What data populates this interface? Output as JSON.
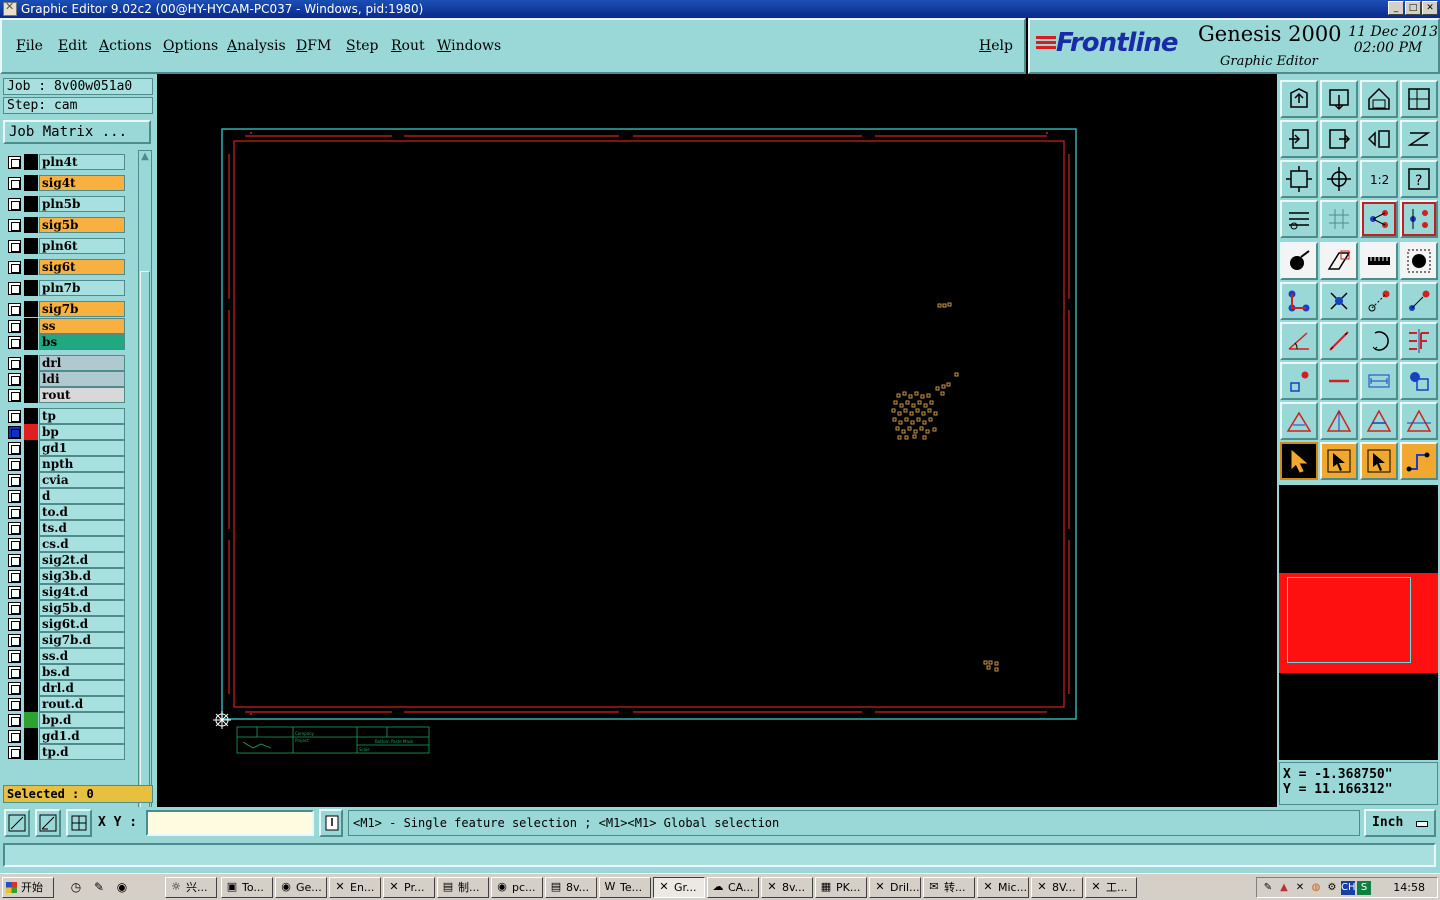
{
  "window": {
    "title": "Graphic Editor 9.02c2 (00@HY-HYCAM-PC037 - Windows, pid:1980)",
    "minimize": "_",
    "maximize": "□",
    "close": "✕"
  },
  "menu": {
    "items": [
      "File",
      "Edit",
      "Actions",
      "Options",
      "Analysis",
      "DFM",
      "Step",
      "Rout",
      "Windows"
    ],
    "help": "Help"
  },
  "brand": {
    "logo": "Frontline",
    "product": "Genesis 2000",
    "subtitle": "Graphic Editor",
    "date": "11 Dec 2013",
    "time": "02:00 PM"
  },
  "job": {
    "job_line": "Job : 8v00w051a0",
    "step_line": "Step: cam",
    "matrix_button": "Job Matrix ..."
  },
  "layers": [
    {
      "name": "pln4t",
      "color": "#a8e0e0",
      "mark": ""
    },
    {
      "name": "sig4t",
      "color": "#f8b040",
      "mark": "↵"
    },
    {
      "name": "pln5b",
      "color": "#a8e0e0",
      "mark": ""
    },
    {
      "name": "sig5b",
      "color": "#f8b040",
      "mark": "↵"
    },
    {
      "name": "pln6t",
      "color": "#a8e0e0",
      "mark": ""
    },
    {
      "name": "sig6t",
      "color": "#f8b040",
      "mark": "↵"
    },
    {
      "name": "pln7b",
      "color": "#a8e0e0",
      "mark": ""
    },
    {
      "name": "sig7b",
      "color": "#f8b040",
      "mark": "↵"
    },
    {
      "name": "ss",
      "color": "#f8b040",
      "mark": "↵"
    },
    {
      "name": "bs",
      "color": "#20a880",
      "mark": "↵"
    },
    {
      "name": "drl",
      "color": "#b0c8d0",
      "mark": ""
    },
    {
      "name": "ldi",
      "color": "#b0c8d0",
      "mark": ""
    },
    {
      "name": "rout",
      "color": "#d8d8d8",
      "mark": ""
    },
    {
      "name": "tp",
      "color": "#a8e0e0",
      "mark": "↵"
    },
    {
      "name": "bp",
      "color": "#a8e0e0",
      "mark": "↵ ⊞"
    },
    {
      "name": "gd1",
      "color": "#a8e0e0",
      "mark": "↵"
    },
    {
      "name": "npth",
      "color": "#a8e0e0",
      "mark": ""
    },
    {
      "name": "cvia",
      "color": "#a8e0e0",
      "mark": ""
    },
    {
      "name": "d",
      "color": "#a8e0e0",
      "mark": ""
    },
    {
      "name": "to.d",
      "color": "#a8e0e0",
      "mark": "↵"
    },
    {
      "name": "ts.d",
      "color": "#a8e0e0",
      "mark": "↵"
    },
    {
      "name": "cs.d",
      "color": "#a8e0e0",
      "mark": "↵"
    },
    {
      "name": "sig2t.d",
      "color": "#a8e0e0",
      "mark": "↵"
    },
    {
      "name": "sig3b.d",
      "color": "#a8e0e0",
      "mark": "↵"
    },
    {
      "name": "sig4t.d",
      "color": "#a8e0e0",
      "mark": "↵"
    },
    {
      "name": "sig5b.d",
      "color": "#a8e0e0",
      "mark": "↵"
    },
    {
      "name": "sig6t.d",
      "color": "#a8e0e0",
      "mark": "↵"
    },
    {
      "name": "sig7b.d",
      "color": "#a8e0e0",
      "mark": "↵"
    },
    {
      "name": "ss.d",
      "color": "#a8e0e0",
      "mark": "↵"
    },
    {
      "name": "bs.d",
      "color": "#a8e0e0",
      "mark": "↵"
    },
    {
      "name": "drl.d",
      "color": "#a8e0e0",
      "mark": ""
    },
    {
      "name": "rout.d",
      "color": "#a8e0e0",
      "mark": ""
    },
    {
      "name": "bp.d",
      "color": "#a8e0e0",
      "mark": "↵"
    },
    {
      "name": "gd1.d",
      "color": "#a8e0e0",
      "mark": "↵"
    },
    {
      "name": "tp.d",
      "color": "#a8e0e0",
      "mark": "↵"
    }
  ],
  "selected": "Selected : 0",
  "coords": {
    "x": "X = -1.368750\"",
    "y": "Y = 11.166312\""
  },
  "statusbar": {
    "xy_label": "X Y :",
    "xy_value": "",
    "prompt": "<M1> - Single feature selection ; <M1><M1> Global selection",
    "unit": "Inch"
  },
  "canvas_text": {
    "title_block_company": "Company",
    "title_block_project": "Project",
    "title_block_side": "Bottom Paste Mask",
    "title_block_scale": "Scale"
  },
  "taskbar": {
    "start": "开始",
    "tasks": [
      "兴...",
      "To...",
      "Ge...",
      "En...",
      "Pr...",
      "制...",
      "pc...",
      "8v...",
      "Te...",
      "Gr...",
      "CA...",
      "8v...",
      "PK...",
      "Dril...",
      "转...",
      "Mic...",
      "8V...",
      "工..."
    ],
    "clock": "14:58",
    "tray_lang": "CH"
  },
  "colors": {
    "panel": "#9ad8d8",
    "outline_cyan": "#30b0b0",
    "outline_red": "#d02020",
    "pads": "#c89a4a",
    "selected_bg": "#e8c040"
  }
}
